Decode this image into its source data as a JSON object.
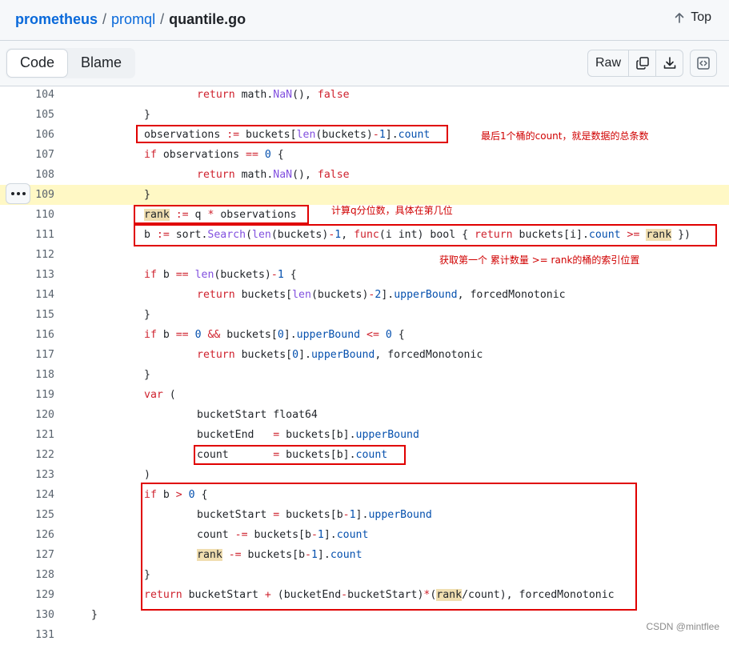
{
  "breadcrumb": {
    "repo": "prometheus",
    "dir": "promql",
    "file": "quantile.go",
    "separator": "/"
  },
  "header": {
    "top_label": "Top",
    "top_icon": "arrow-up-icon"
  },
  "toolbar": {
    "tabs": [
      {
        "label": "Code",
        "active": true
      },
      {
        "label": "Blame",
        "active": false
      }
    ],
    "raw_label": "Raw",
    "copy_icon": "copy-icon",
    "download_icon": "download-icon",
    "symbols_icon": "code-square-icon"
  },
  "code": {
    "highlighted_line": 109,
    "lines": [
      {
        "n": "104",
        "tokens": [
          [
            "t",
            "\t\t"
          ],
          [
            "kw",
            "return"
          ],
          [
            "t",
            " math."
          ],
          [
            "fn",
            "NaN"
          ],
          [
            "t",
            "(), "
          ],
          [
            "kw",
            "false"
          ]
        ]
      },
      {
        "n": "105",
        "tokens": [
          [
            "t",
            "\t}"
          ]
        ]
      },
      {
        "n": "106",
        "tokens": [
          [
            "t",
            "\tobservations "
          ],
          [
            "kw",
            ":="
          ],
          [
            "t",
            " buckets["
          ],
          [
            "fn",
            "len"
          ],
          [
            "t",
            "(buckets)"
          ],
          [
            "kw",
            "-"
          ],
          [
            "pr",
            "1"
          ],
          [
            "t",
            "]."
          ],
          [
            "pr",
            "count"
          ]
        ]
      },
      {
        "n": "107",
        "tokens": [
          [
            "t",
            "\t"
          ],
          [
            "kw",
            "if"
          ],
          [
            "t",
            " observations "
          ],
          [
            "kw",
            "=="
          ],
          [
            "t",
            " "
          ],
          [
            "pr",
            "0"
          ],
          [
            "t",
            " {"
          ]
        ]
      },
      {
        "n": "108",
        "tokens": [
          [
            "t",
            "\t\t"
          ],
          [
            "kw",
            "return"
          ],
          [
            "t",
            " math."
          ],
          [
            "fn",
            "NaN"
          ],
          [
            "t",
            "(), "
          ],
          [
            "kw",
            "false"
          ]
        ]
      },
      {
        "n": "109",
        "tokens": [
          [
            "t",
            "\t}"
          ]
        ]
      },
      {
        "n": "110",
        "tokens": [
          [
            "t",
            "\t"
          ],
          [
            "mk",
            "rank"
          ],
          [
            "t",
            " "
          ],
          [
            "kw",
            ":="
          ],
          [
            "t",
            " q "
          ],
          [
            "kw",
            "*"
          ],
          [
            "t",
            " observations"
          ]
        ]
      },
      {
        "n": "111",
        "tokens": [
          [
            "t",
            "\tb "
          ],
          [
            "kw",
            ":="
          ],
          [
            "t",
            " sort."
          ],
          [
            "fn",
            "Search"
          ],
          [
            "t",
            "("
          ],
          [
            "fn",
            "len"
          ],
          [
            "t",
            "(buckets)"
          ],
          [
            "kw",
            "-"
          ],
          [
            "pr",
            "1"
          ],
          [
            "t",
            ", "
          ],
          [
            "kw",
            "func"
          ],
          [
            "t",
            "(i int) bool { "
          ],
          [
            "kw",
            "return"
          ],
          [
            "t",
            " buckets[i]."
          ],
          [
            "pr",
            "count"
          ],
          [
            "t",
            " "
          ],
          [
            "kw",
            ">="
          ],
          [
            "t",
            " "
          ],
          [
            "mk",
            "rank"
          ],
          [
            "t",
            " })"
          ]
        ]
      },
      {
        "n": "112",
        "tokens": []
      },
      {
        "n": "113",
        "tokens": [
          [
            "t",
            "\t"
          ],
          [
            "kw",
            "if"
          ],
          [
            "t",
            " b "
          ],
          [
            "kw",
            "=="
          ],
          [
            "t",
            " "
          ],
          [
            "fn",
            "len"
          ],
          [
            "t",
            "(buckets)"
          ],
          [
            "kw",
            "-"
          ],
          [
            "pr",
            "1"
          ],
          [
            "t",
            " {"
          ]
        ]
      },
      {
        "n": "114",
        "tokens": [
          [
            "t",
            "\t\t"
          ],
          [
            "kw",
            "return"
          ],
          [
            "t",
            " buckets["
          ],
          [
            "fn",
            "len"
          ],
          [
            "t",
            "(buckets)"
          ],
          [
            "kw",
            "-"
          ],
          [
            "pr",
            "2"
          ],
          [
            "t",
            "]."
          ],
          [
            "pr",
            "upperBound"
          ],
          [
            "t",
            ", forcedMonotonic"
          ]
        ]
      },
      {
        "n": "115",
        "tokens": [
          [
            "t",
            "\t}"
          ]
        ]
      },
      {
        "n": "116",
        "tokens": [
          [
            "t",
            "\t"
          ],
          [
            "kw",
            "if"
          ],
          [
            "t",
            " b "
          ],
          [
            "kw",
            "=="
          ],
          [
            "t",
            " "
          ],
          [
            "pr",
            "0"
          ],
          [
            "t",
            " "
          ],
          [
            "kw",
            "&&"
          ],
          [
            "t",
            " buckets["
          ],
          [
            "pr",
            "0"
          ],
          [
            "t",
            "]."
          ],
          [
            "pr",
            "upperBound"
          ],
          [
            "t",
            " "
          ],
          [
            "kw",
            "<="
          ],
          [
            "t",
            " "
          ],
          [
            "pr",
            "0"
          ],
          [
            "t",
            " {"
          ]
        ]
      },
      {
        "n": "117",
        "tokens": [
          [
            "t",
            "\t\t"
          ],
          [
            "kw",
            "return"
          ],
          [
            "t",
            " buckets["
          ],
          [
            "pr",
            "0"
          ],
          [
            "t",
            "]."
          ],
          [
            "pr",
            "upperBound"
          ],
          [
            "t",
            ", forcedMonotonic"
          ]
        ]
      },
      {
        "n": "118",
        "tokens": [
          [
            "t",
            "\t}"
          ]
        ]
      },
      {
        "n": "119",
        "tokens": [
          [
            "t",
            "\t"
          ],
          [
            "kw",
            "var"
          ],
          [
            "t",
            " ("
          ]
        ]
      },
      {
        "n": "120",
        "tokens": [
          [
            "t",
            "\t\tbucketStart float64"
          ]
        ]
      },
      {
        "n": "121",
        "tokens": [
          [
            "t",
            "\t\tbucketEnd   "
          ],
          [
            "kw",
            "="
          ],
          [
            "t",
            " buckets[b]."
          ],
          [
            "pr",
            "upperBound"
          ]
        ]
      },
      {
        "n": "122",
        "tokens": [
          [
            "t",
            "\t\tcount       "
          ],
          [
            "kw",
            "="
          ],
          [
            "t",
            " buckets[b]."
          ],
          [
            "pr",
            "count"
          ]
        ]
      },
      {
        "n": "123",
        "tokens": [
          [
            "t",
            "\t)"
          ]
        ]
      },
      {
        "n": "124",
        "tokens": [
          [
            "t",
            "\t"
          ],
          [
            "kw",
            "if"
          ],
          [
            "t",
            " b "
          ],
          [
            "kw",
            ">"
          ],
          [
            "t",
            " "
          ],
          [
            "pr",
            "0"
          ],
          [
            "t",
            " {"
          ]
        ]
      },
      {
        "n": "125",
        "tokens": [
          [
            "t",
            "\t\tbucketStart "
          ],
          [
            "kw",
            "="
          ],
          [
            "t",
            " buckets[b"
          ],
          [
            "kw",
            "-"
          ],
          [
            "pr",
            "1"
          ],
          [
            "t",
            "]."
          ],
          [
            "pr",
            "upperBound"
          ]
        ]
      },
      {
        "n": "126",
        "tokens": [
          [
            "t",
            "\t\tcount "
          ],
          [
            "kw",
            "-="
          ],
          [
            "t",
            " buckets[b"
          ],
          [
            "kw",
            "-"
          ],
          [
            "pr",
            "1"
          ],
          [
            "t",
            "]."
          ],
          [
            "pr",
            "count"
          ]
        ]
      },
      {
        "n": "127",
        "tokens": [
          [
            "t",
            "\t\t"
          ],
          [
            "mk",
            "rank"
          ],
          [
            "t",
            " "
          ],
          [
            "kw",
            "-="
          ],
          [
            "t",
            " buckets[b"
          ],
          [
            "kw",
            "-"
          ],
          [
            "pr",
            "1"
          ],
          [
            "t",
            "]."
          ],
          [
            "pr",
            "count"
          ]
        ]
      },
      {
        "n": "128",
        "tokens": [
          [
            "t",
            "\t}"
          ]
        ]
      },
      {
        "n": "129",
        "tokens": [
          [
            "t",
            "\t"
          ],
          [
            "kw",
            "return"
          ],
          [
            "t",
            " bucketStart "
          ],
          [
            "kw",
            "+"
          ],
          [
            "t",
            " (bucketEnd"
          ],
          [
            "kw",
            "-"
          ],
          [
            "t",
            "bucketStart)"
          ],
          [
            "kw",
            "*"
          ],
          [
            "t",
            "("
          ],
          [
            "mk",
            "rank"
          ],
          [
            "t",
            "/count), forcedMonotonic"
          ]
        ]
      },
      {
        "n": "130",
        "tokens": [
          [
            "t",
            "}"
          ]
        ]
      },
      {
        "n": "131",
        "tokens": []
      }
    ]
  },
  "annotations": {
    "note_106": "最后1个桶的count，就是数据的总条数",
    "note_110": "计算q分位数，具体在第几位",
    "note_111": "获取第一个 累计数量 >= rank的桶的索引位置"
  },
  "colors": {
    "keyword": "#cf222e",
    "function": "#8250df",
    "property": "#0550ae",
    "link": "#0969da",
    "annotation": "#e00000",
    "line_highlight": "#fff8c5",
    "match_highlight": "#f0deb0"
  },
  "watermark": "CSDN @mintflee"
}
